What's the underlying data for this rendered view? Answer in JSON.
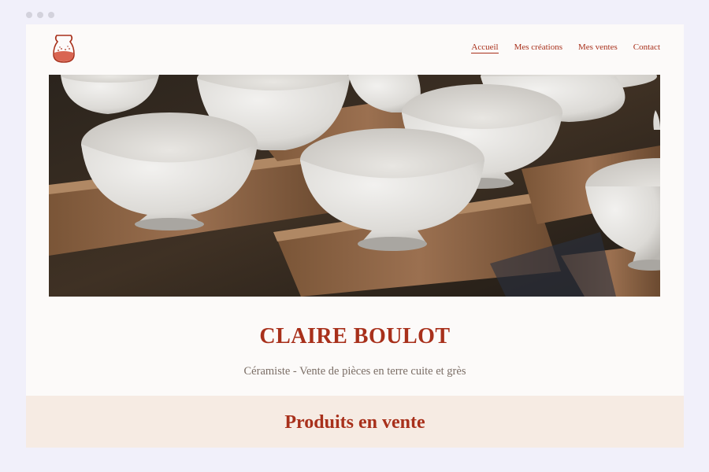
{
  "browser": {
    "controls": [
      "dot",
      "dot",
      "dot"
    ]
  },
  "header": {
    "logo_icon": "vase-icon",
    "nav": [
      {
        "label": "Accueil",
        "active": true
      },
      {
        "label": "Mes créations",
        "active": false
      },
      {
        "label": "Mes ventes",
        "active": false
      },
      {
        "label": "Contact",
        "active": false
      }
    ]
  },
  "hero": {
    "image": "white-ceramic-bowls-on-wooden-boards"
  },
  "main": {
    "title": "CLAIRE BOULOT",
    "subtitle": "Céramiste - Vente de pièces en terre cuite et grès"
  },
  "products": {
    "title": "Produits en vente"
  },
  "colors": {
    "accent": "#a8301b",
    "background": "#fcfaf9",
    "band": "#f6ebe3",
    "page": "#f1f0fa"
  }
}
